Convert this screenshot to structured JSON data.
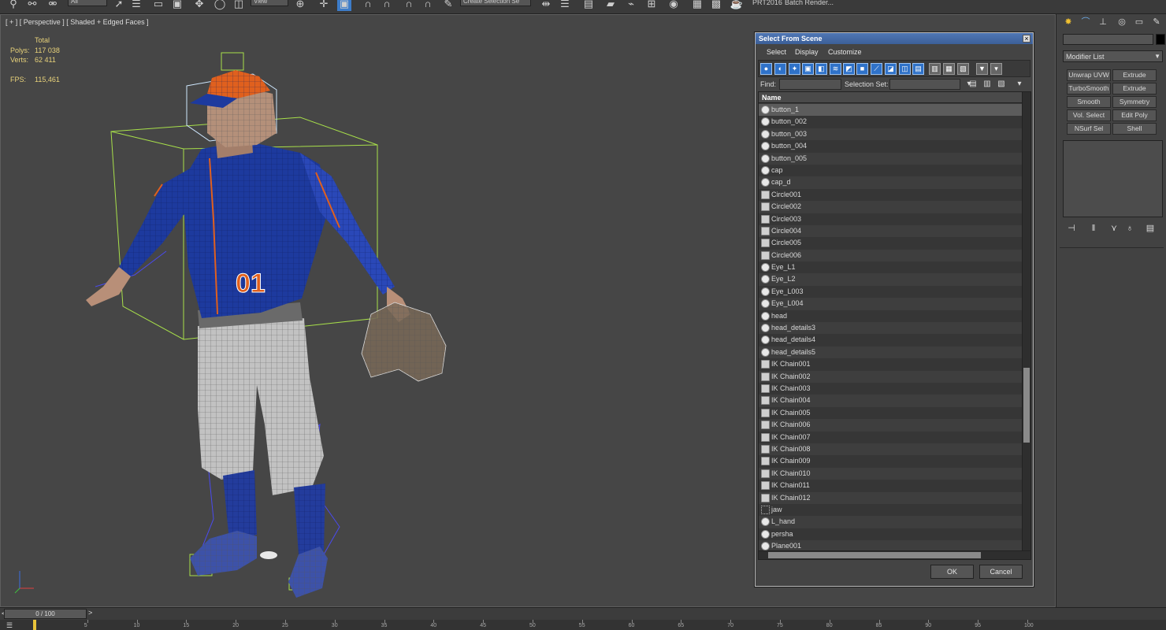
{
  "toolbar": {
    "selection_filter": "All",
    "ref_coord": "View",
    "named_sel": "Create Selection Se",
    "prt_label": "PRT2016",
    "batch_render": "Batch Render..."
  },
  "viewport": {
    "label": "[ + ] [ Perspective ] [ Shaded + Edged Faces ]",
    "stats": {
      "total_label": "Total",
      "polys_label": "Polys:",
      "polys_value": "117 038",
      "verts_label": "Verts:",
      "verts_value": "62 411",
      "fps_label": "FPS:",
      "fps_value": "115,461"
    },
    "jersey_number": "01"
  },
  "dialog": {
    "title": "Select From Scene",
    "close_glyph": "×",
    "menu": [
      "Select",
      "Display",
      "Customize"
    ],
    "find_label": "Find:",
    "selection_set_label": "Selection Set:",
    "column_name": "Name",
    "items": [
      {
        "label": "button_1",
        "kind": "geo",
        "selected": true
      },
      {
        "label": "button_002",
        "kind": "geo"
      },
      {
        "label": "button_003",
        "kind": "geo"
      },
      {
        "label": "button_004",
        "kind": "geo"
      },
      {
        "label": "button_005",
        "kind": "geo"
      },
      {
        "label": "cap",
        "kind": "geo"
      },
      {
        "label": "cap_d",
        "kind": "geo"
      },
      {
        "label": "Circle001",
        "kind": "helper"
      },
      {
        "label": "Circle002",
        "kind": "helper"
      },
      {
        "label": "Circle003",
        "kind": "helper"
      },
      {
        "label": "Circle004",
        "kind": "helper"
      },
      {
        "label": "Circle005",
        "kind": "helper"
      },
      {
        "label": "Circle006",
        "kind": "helper"
      },
      {
        "label": "Eye_L1",
        "kind": "geo"
      },
      {
        "label": "Eye_L2",
        "kind": "geo"
      },
      {
        "label": "Eye_L003",
        "kind": "geo"
      },
      {
        "label": "Eye_L004",
        "kind": "geo"
      },
      {
        "label": "head",
        "kind": "geo"
      },
      {
        "label": "head_details3",
        "kind": "geo"
      },
      {
        "label": "head_details4",
        "kind": "geo"
      },
      {
        "label": "head_details5",
        "kind": "geo"
      },
      {
        "label": "IK Chain001",
        "kind": "helper"
      },
      {
        "label": "IK Chain002",
        "kind": "helper"
      },
      {
        "label": "IK Chain003",
        "kind": "helper"
      },
      {
        "label": "IK Chain004",
        "kind": "helper"
      },
      {
        "label": "IK Chain005",
        "kind": "helper"
      },
      {
        "label": "IK Chain006",
        "kind": "helper"
      },
      {
        "label": "IK Chain007",
        "kind": "helper"
      },
      {
        "label": "IK Chain008",
        "kind": "helper"
      },
      {
        "label": "IK Chain009",
        "kind": "helper"
      },
      {
        "label": "IK Chain010",
        "kind": "helper"
      },
      {
        "label": "IK Chain011",
        "kind": "helper"
      },
      {
        "label": "IK Chain012",
        "kind": "helper"
      },
      {
        "label": "jaw",
        "kind": "bone"
      },
      {
        "label": "L_hand",
        "kind": "geo"
      },
      {
        "label": "persha",
        "kind": "geo"
      },
      {
        "label": "Plane001",
        "kind": "geo"
      }
    ],
    "ok_label": "OK",
    "cancel_label": "Cancel"
  },
  "command_panel": {
    "modifier_list": "Modifier List",
    "modifier_buttons": [
      "Unwrap UVW",
      "Extrude",
      "TurboSmooth",
      "Extrude",
      "Smooth",
      "Symmetry",
      "Vol. Select",
      "Edit Poly",
      "NSurf Sel",
      "Shell"
    ]
  },
  "timeline": {
    "frame_display": "0 / 100",
    "prev": "<",
    "next": ">",
    "ticks": [
      "5",
      "10",
      "15",
      "20",
      "25",
      "30",
      "35",
      "40",
      "45",
      "50",
      "55",
      "60",
      "65",
      "70",
      "75",
      "80",
      "85",
      "90",
      "95",
      "100"
    ]
  },
  "colors": {
    "viewport_bg": "#464646",
    "stats_text": "#e8d27a",
    "jersey_blue": "#1d3a9e",
    "accent_orange": "#e0601e",
    "dialog_title": "#4f77b5",
    "selected_row": "#5c5c5c"
  }
}
